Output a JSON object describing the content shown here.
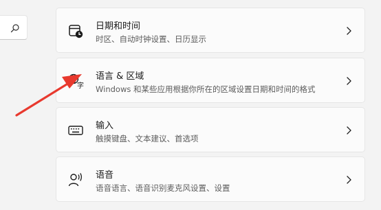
{
  "settings_list": [
    {
      "id": "date-time",
      "title": "日期和时间",
      "subtitle": "时区、自动时钟设置、日历显示",
      "icon": "calendar-clock-icon"
    },
    {
      "id": "language-region",
      "title": "语言 & 区域",
      "subtitle": "Windows 和某些应用根据你所在的区域设置日期和时间的格式",
      "icon": "language-globe-icon"
    },
    {
      "id": "typing",
      "title": "输入",
      "subtitle": "触摸键盘、文本建议、首选项",
      "icon": "keyboard-icon"
    },
    {
      "id": "speech",
      "title": "语音",
      "subtitle": "语音语言、语音识别麦克风设置、设置",
      "icon": "speech-person-icon"
    }
  ],
  "search": {
    "icon": "search-icon"
  },
  "annotation": {
    "icon": "red-arrow-annotation",
    "color": "#e8392e"
  }
}
